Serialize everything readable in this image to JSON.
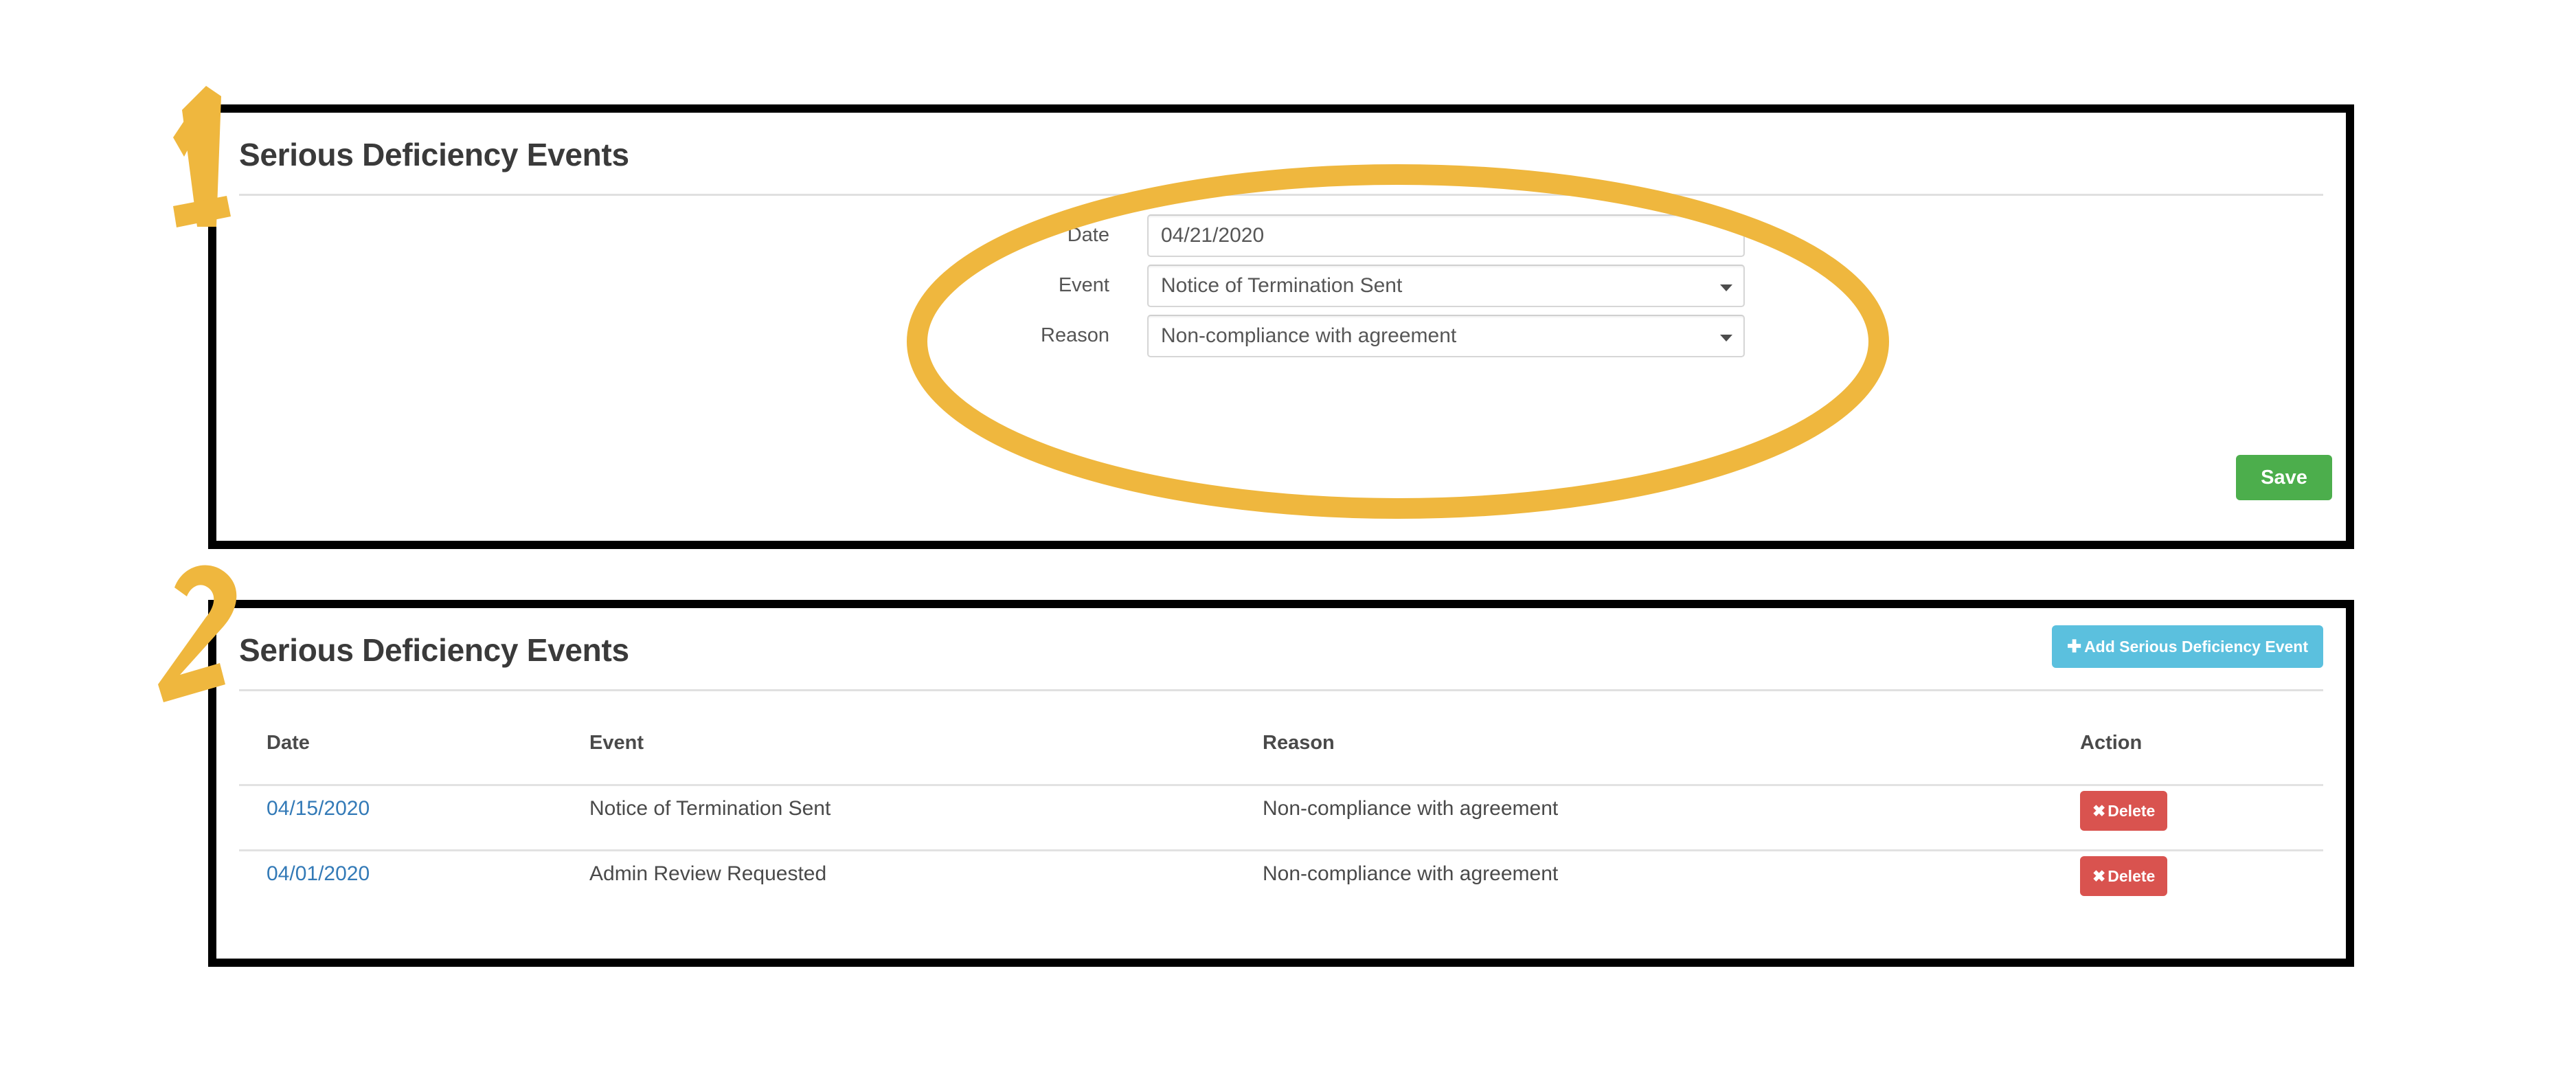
{
  "form_panel": {
    "title": "Serious Deficiency Events",
    "fields": [
      {
        "label": "Date",
        "value": "04/21/2020",
        "type": "text",
        "caret": false
      },
      {
        "label": "Event",
        "value": "Notice of Termination Sent",
        "type": "select",
        "caret": true
      },
      {
        "label": "Reason",
        "value": "Non-compliance with agreement",
        "type": "select",
        "caret": true
      }
    ],
    "save_label": "Save"
  },
  "table_panel": {
    "title": "Serious Deficiency Events",
    "add_button_label": "Add Serious Deficiency Event",
    "add_button_icon": "plus-icon",
    "columns": [
      "Date",
      "Event",
      "Reason",
      "Action"
    ],
    "rows": [
      {
        "date": "04/15/2020",
        "event": "Notice of Termination Sent",
        "reason": "Non-compliance with agreement",
        "action_label": "Delete",
        "action_icon": "close-x-icon"
      },
      {
        "date": "04/01/2020",
        "event": "Admin Review Requested",
        "reason": "Non-compliance with agreement",
        "action_label": "Delete",
        "action_icon": "close-x-icon"
      }
    ]
  },
  "annotations": {
    "marker_one": "1",
    "marker_two": "2",
    "highlight_color": "#efb73e",
    "outline_color": "#000000"
  },
  "colors": {
    "save_green": "#4cae4c",
    "add_blue": "#5bc0de",
    "delete_red": "#d9534f",
    "link_blue": "#337ab7",
    "annotation_gold": "#efb73e"
  }
}
